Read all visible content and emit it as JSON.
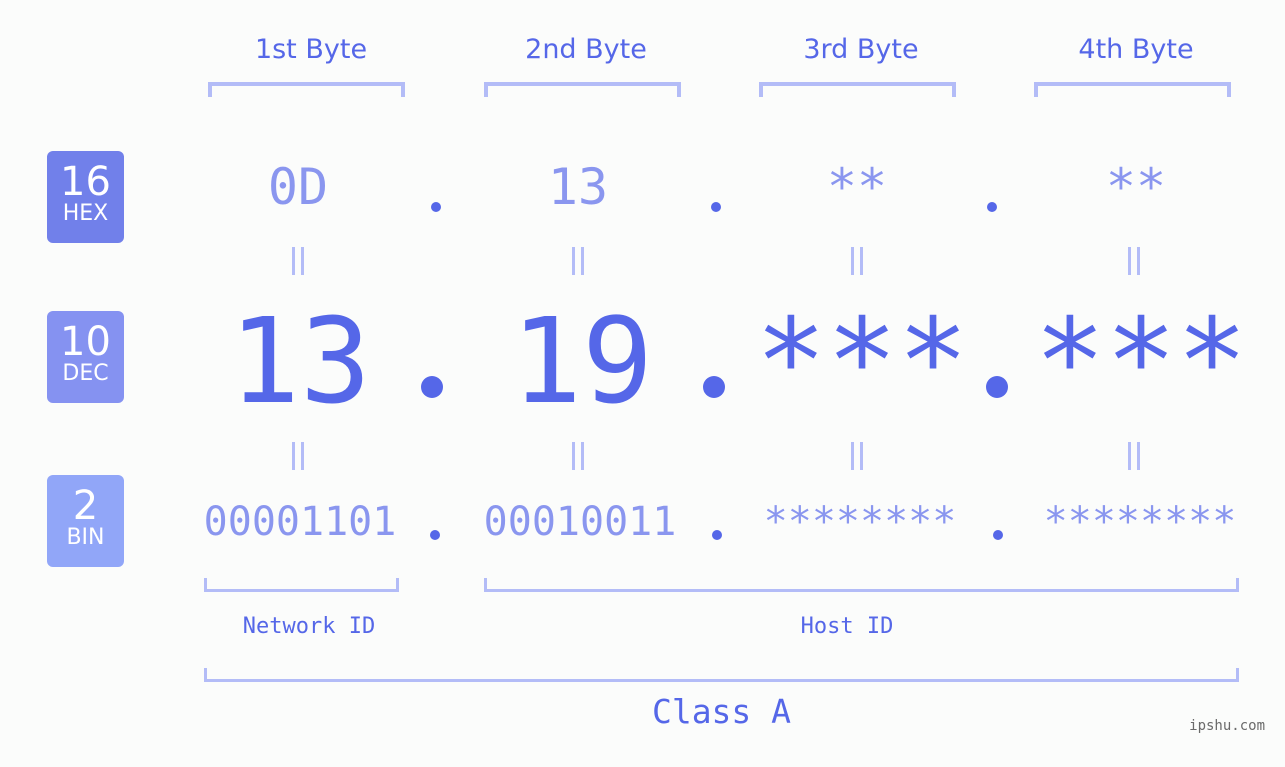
{
  "badges": [
    {
      "base": "16",
      "label": "HEX",
      "color": "#7180ea"
    },
    {
      "base": "10",
      "label": "DEC",
      "color": "#8592f1"
    },
    {
      "base": "2",
      "label": "BIN",
      "color": "#91a6f8"
    }
  ],
  "bytes": [
    {
      "header": "1st Byte",
      "hex": "0D",
      "dec": "13",
      "bin": "00001101"
    },
    {
      "header": "2nd Byte",
      "hex": "13",
      "dec": "19",
      "bin": "00010011"
    },
    {
      "header": "3rd Byte",
      "hex": "**",
      "dec": "***",
      "bin": "********"
    },
    {
      "header": "4th Byte",
      "hex": "**",
      "dec": "***",
      "bin": "********"
    }
  ],
  "separator": ".",
  "equals_symbol": "=",
  "segments": {
    "network_id": "Network ID",
    "host_id": "Host ID"
  },
  "ip_class": "Class A",
  "watermark": "ipshu.com",
  "colors": {
    "accent": "#5567e8",
    "light_text": "#8a96ef",
    "bracket": "#b3bcf7",
    "background": "#fbfcfb"
  }
}
